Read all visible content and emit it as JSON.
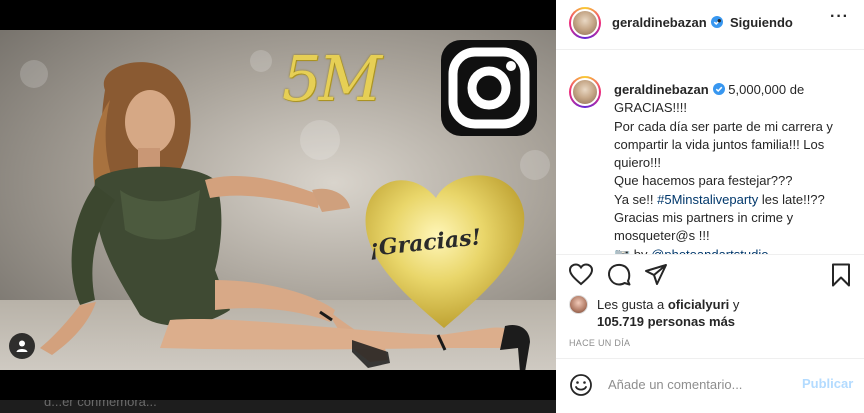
{
  "header": {
    "username": "geraldinebazan",
    "dot": "•",
    "follow_status": "Siguiendo",
    "more": "···"
  },
  "image": {
    "badge_text": "5M",
    "gracias_text": "¡Gracias!",
    "below_text": "d...er  conmemora..."
  },
  "caption": {
    "username": "geraldinebazan",
    "first_text": "5,000,000 de",
    "lines": [
      "GRACIAS!!!!",
      "Por cada día ser parte de mi carrera y",
      "compartir la vida juntos familia!!! Los",
      "quiero!!!",
      "Que hacemos para festejar???",
      "Ya se!! ",
      "Gracias mis partners in crime y",
      "mosqueter@s !!!",
      " by "
    ],
    "hashtag": "#5Minstaliveparty",
    "hashtag_suffix": " les late!!??",
    "camera_emoji": "📷",
    "mention": "@photoandartstudio_"
  },
  "likes": {
    "prefix": "Les gusta a ",
    "user": "oficialyuri",
    "suffix": " y",
    "count_line": "105.719 personas más"
  },
  "time_ago": "HACE UN DÍA",
  "comment": {
    "placeholder": "Añade un comentario...",
    "publish_label": "Publicar"
  },
  "colors": {
    "link": "#00376b",
    "publish_disabled": "#b3dbff",
    "gold": "#e6cf55",
    "verified": "#3897f0"
  },
  "icons": [
    "more-icon",
    "verified-icon",
    "heart-icon",
    "comment-icon",
    "share-icon",
    "bookmark-icon",
    "emoji-icon",
    "user-tag-icon",
    "instagram-logo"
  ]
}
